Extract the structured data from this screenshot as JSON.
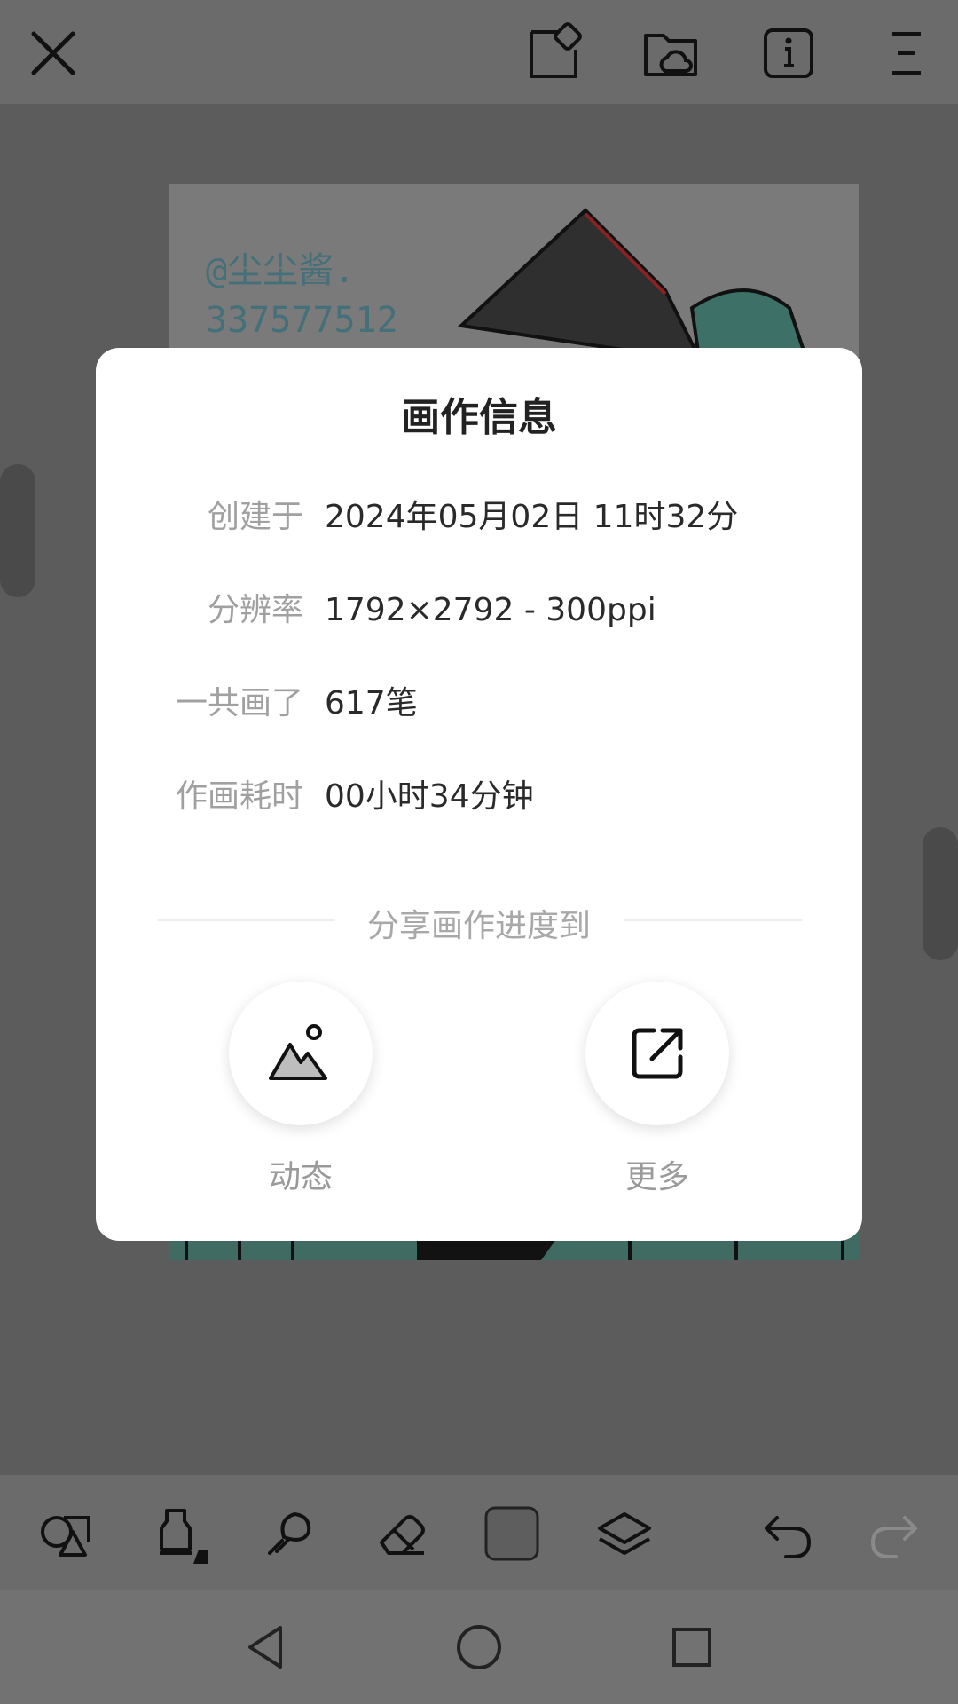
{
  "topbar": {
    "icons": [
      "close-icon",
      "canvas-icon",
      "cloud-folder-icon",
      "info-icon",
      "menu-icon"
    ]
  },
  "canvas": {
    "watermark_line1": "@尘尘酱.",
    "watermark_line2": "337577512"
  },
  "dialog": {
    "title": "画作信息",
    "rows": [
      {
        "label": "创建于",
        "value": "2024年05月02日 11时32分"
      },
      {
        "label": "分辨率",
        "value": "1792×2792 - 300ppi"
      },
      {
        "label": "一共画了",
        "value": "617笔"
      },
      {
        "label": "作画耗时",
        "value": "00小时34分钟"
      }
    ],
    "share_label": "分享画作进度到",
    "share_options": [
      {
        "label": "动态",
        "icon": "mountain-image-icon"
      },
      {
        "label": "更多",
        "icon": "external-share-icon"
      }
    ]
  },
  "toolbar": {
    "tools": [
      "shapes-icon",
      "brush-icon",
      "smudge-icon",
      "eraser-icon",
      "color-swatch-icon",
      "layers-icon",
      "undo-icon",
      "redo-icon"
    ]
  },
  "navbar": {
    "buttons": [
      "back-icon",
      "home-icon",
      "recents-icon"
    ]
  },
  "colors": {
    "overlay": "#5c5c5c",
    "dialog_bg": "#ffffff",
    "label_gray": "#a0a0a0",
    "value_dark": "#2a2a2a"
  }
}
